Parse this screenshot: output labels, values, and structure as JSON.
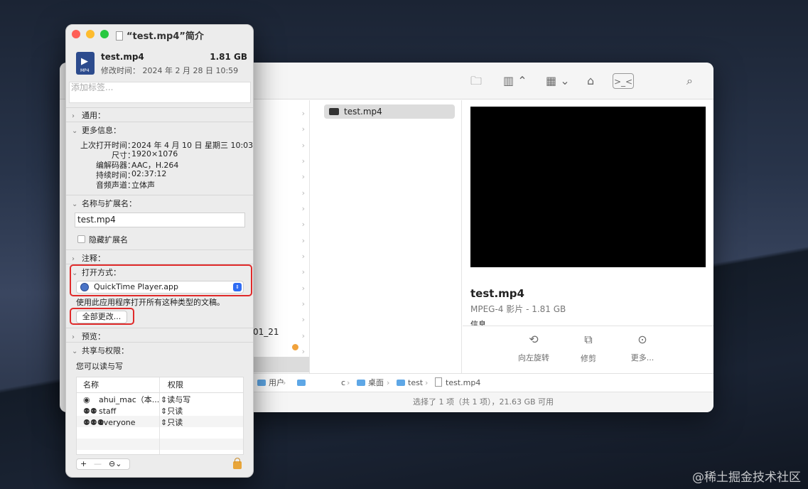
{
  "watermark": "@稀土掘金技术社区",
  "finder": {
    "selected_file": "test.mp4",
    "col1_partial_text": "01_21",
    "preview": {
      "name": "test.mp4",
      "meta": "MPEG-4 影片 - 1.81 GB",
      "cut_text": "信息",
      "actions": [
        {
          "icon": "rotate-left-icon",
          "glyph": "⟲",
          "label": "向左旋转"
        },
        {
          "icon": "trim-icon",
          "glyph": "⧉",
          "label": "修剪"
        },
        {
          "icon": "more-icon",
          "glyph": "⊙",
          "label": "更多..."
        }
      ]
    },
    "path": [
      "用户",
      "桌面",
      "test",
      "test.mp4"
    ],
    "path_partial": "c",
    "status": "选择了 1 项（共 1 项），21.63 GB 可用"
  },
  "info": {
    "title": "“test.mp4”简介",
    "file_name": "test.mp4",
    "file_size": "1.81 GB",
    "file_icon_label": "MP4",
    "modified": "修改时间： 2024 年 2 月 28 日 10:59",
    "tags_placeholder": "添加标签...",
    "sections": {
      "general": "通用：",
      "more_info": "更多信息：",
      "name_ext": "名称与扩展名：",
      "comments": "注释：",
      "open_with": "打开方式：",
      "preview": "预览：",
      "sharing": "共享与权限："
    },
    "more_info": [
      {
        "key": "上次打开时间：",
        "value": "2024 年 4 月 10 日 星期三 10:03"
      },
      {
        "key": "尺寸：",
        "value": "1920×1076"
      },
      {
        "key": "编解码器：",
        "value": "AAC，H.264"
      },
      {
        "key": "持续时间：",
        "value": "02:37:12"
      },
      {
        "key": "音频声道：",
        "value": "立体声"
      }
    ],
    "name_value": "test.mp4",
    "hide_ext_label": "隐藏扩展名",
    "open_with_app": "QuickTime Player.app",
    "open_with_hint": "使用此应用程序打开所有这种类型的文稿。",
    "change_all_label": "全部更改...",
    "rw_text": "您可以读与写",
    "perm_headers": {
      "name": "名称",
      "priv": "权限"
    },
    "permissions": [
      {
        "icon": "single-user-icon",
        "glyph": "◉",
        "user": "ahui_mac（本...",
        "priv": "⇕读与写"
      },
      {
        "icon": "group-icon",
        "glyph": "⚉⚉",
        "user": "staff",
        "priv": "⇕只读"
      },
      {
        "icon": "everyone-icon",
        "glyph": "⚉⚉⚉",
        "user": "everyone",
        "priv": "⇕只读"
      }
    ],
    "perm_buttons": {
      "add": "+",
      "remove": "—",
      "action": "⊖⌄"
    }
  }
}
